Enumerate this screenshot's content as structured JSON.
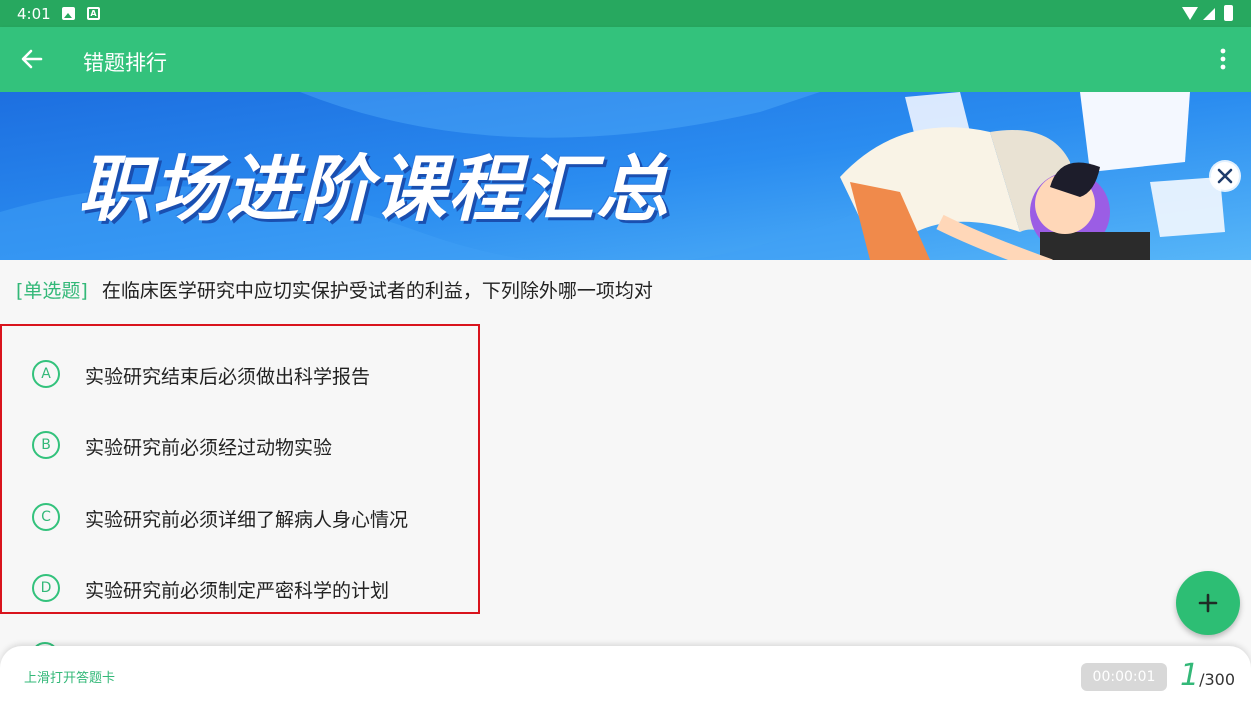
{
  "status_bar": {
    "time": "4:01"
  },
  "app_bar": {
    "title": "错题排行"
  },
  "banner": {
    "headline": "职场进阶课程汇总"
  },
  "question": {
    "type_label": "[单选题]",
    "text": "在临床医学研究中应切实保护受试者的利益，下列除外哪一项均对"
  },
  "options": [
    {
      "letter": "A",
      "text": "实验研究结束后必须做出科学报告"
    },
    {
      "letter": "B",
      "text": "实验研究前必须经过动物实验"
    },
    {
      "letter": "C",
      "text": "实验研究前必须详细了解病人身心情况"
    },
    {
      "letter": "D",
      "text": "实验研究前必须制定严密科学的计划"
    }
  ],
  "bottom_sheet": {
    "hint": "上滑打开答题卡",
    "timer": "00:00:01",
    "current": "1",
    "total": "/300"
  },
  "colors": {
    "accent": "#33c27c",
    "status_bar": "#27a85f",
    "highlight_border": "#d9141d"
  },
  "icons": [
    "back-arrow-icon",
    "more-vertical-icon",
    "close-icon",
    "plus-icon",
    "image-icon",
    "a-icon",
    "wifi-icon",
    "signal-icon",
    "battery-icon"
  ]
}
